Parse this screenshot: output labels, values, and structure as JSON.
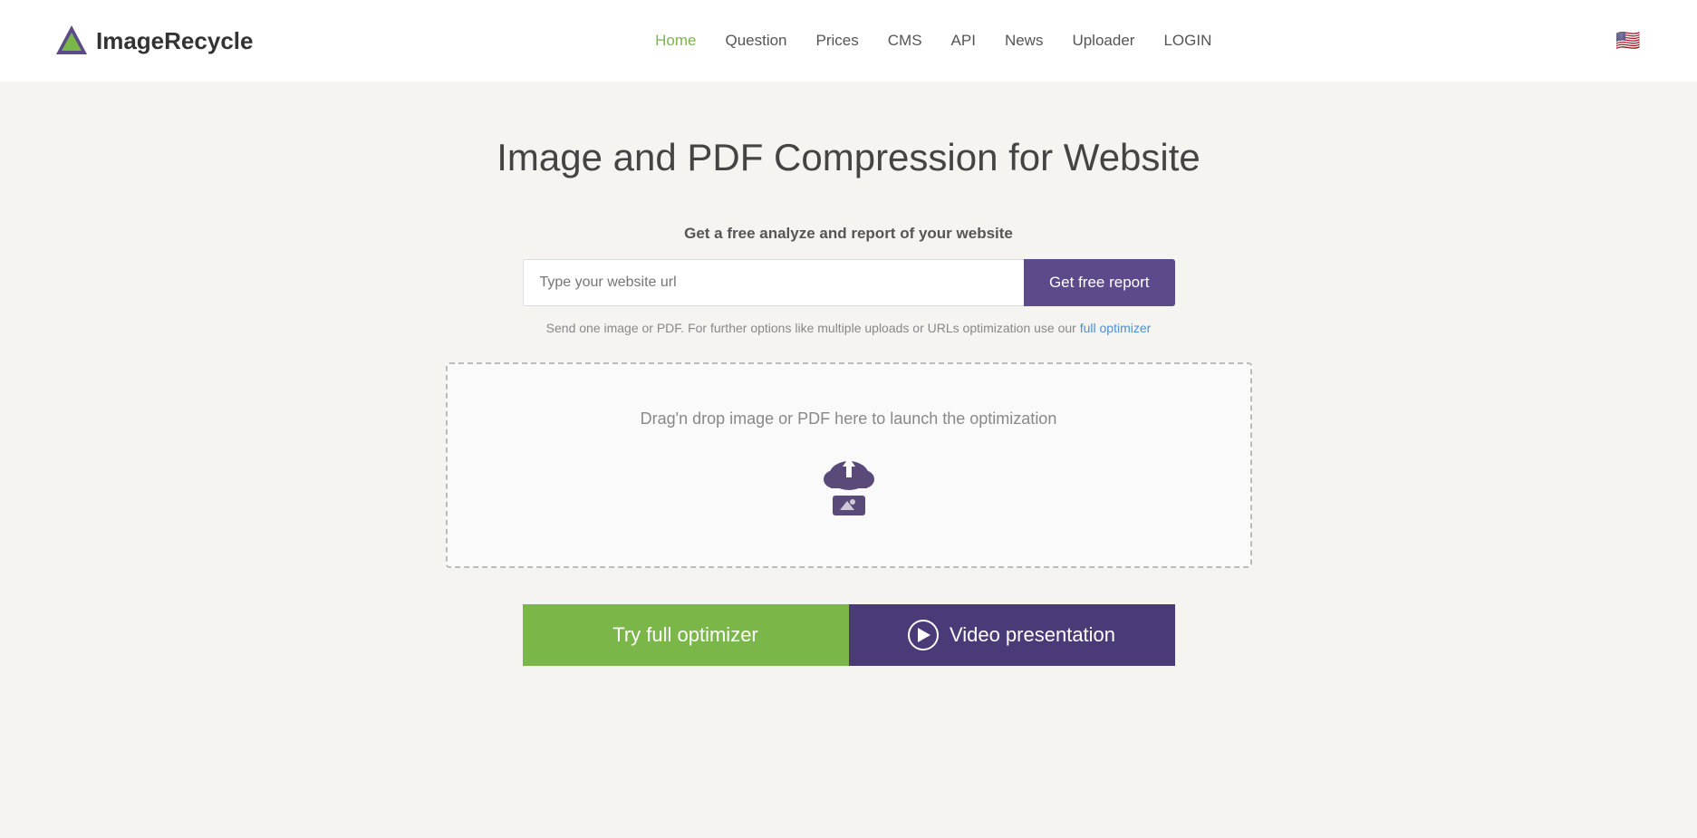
{
  "header": {
    "logo_text_light": "Image",
    "logo_text_bold": "Recycle",
    "nav": [
      {
        "label": "Home",
        "active": true,
        "id": "home"
      },
      {
        "label": "Question",
        "active": false,
        "id": "question"
      },
      {
        "label": "Prices",
        "active": false,
        "id": "prices"
      },
      {
        "label": "CMS",
        "active": false,
        "id": "cms"
      },
      {
        "label": "API",
        "active": false,
        "id": "api"
      },
      {
        "label": "News",
        "active": false,
        "id": "news"
      },
      {
        "label": "Uploader",
        "active": false,
        "id": "uploader"
      },
      {
        "label": "LOGIN",
        "active": false,
        "id": "login"
      }
    ],
    "flag_emoji": "🇺🇸"
  },
  "main": {
    "title": "Image and PDF Compression for Website",
    "subtitle": "Get a free analyze and report of your website",
    "url_placeholder": "Type your website url",
    "get_report_button": "Get free report",
    "note_text": "Send one image or PDF. For further options like multiple uploads or URLs optimization use our",
    "note_link": "full optimizer",
    "drop_zone_text": "Drag'n drop image or PDF here to launch the optimization",
    "btn_optimizer_label": "Try full optimizer",
    "btn_video_label": "Video presentation"
  }
}
